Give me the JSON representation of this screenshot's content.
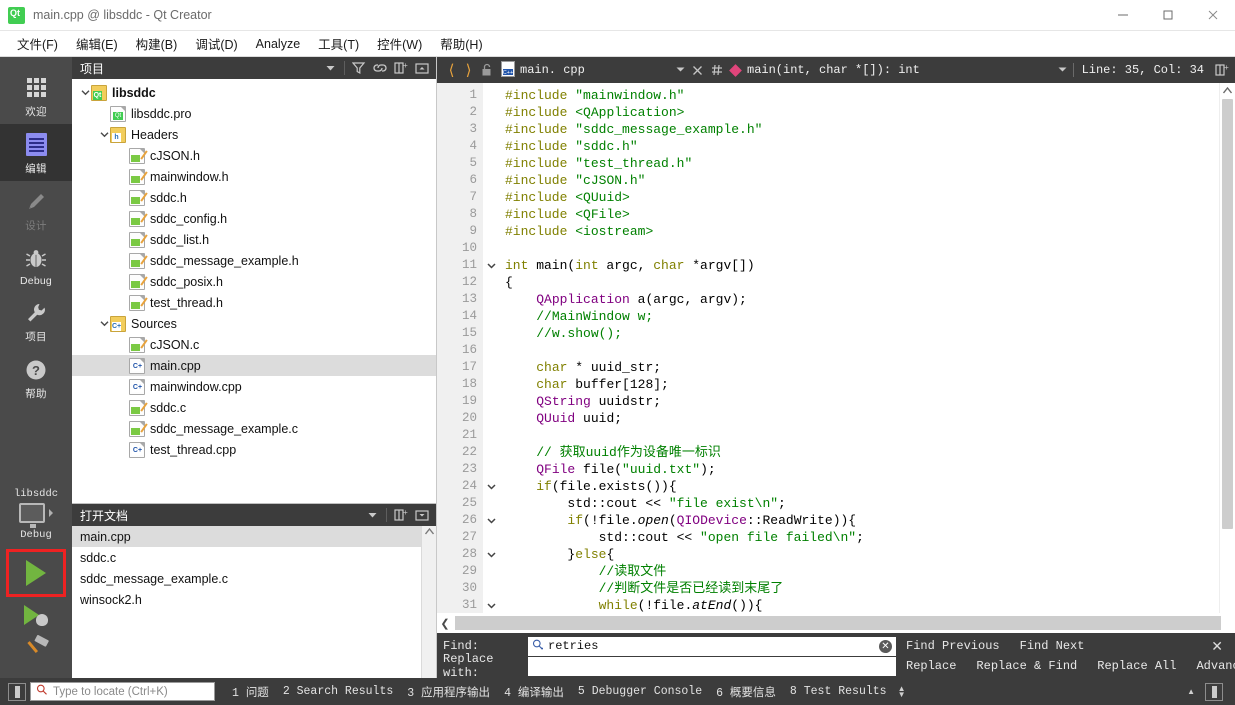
{
  "window": {
    "title": "main.cpp @ libsddc - Qt Creator",
    "logo_text": "Qt",
    "minimize": "–",
    "maximize": "□",
    "close": "✕"
  },
  "menubar": {
    "items": [
      {
        "label": "文件(F)"
      },
      {
        "label": "编辑(E)"
      },
      {
        "label": "构建(B)"
      },
      {
        "label": "调试(D)"
      },
      {
        "label": "Analyze"
      },
      {
        "label": "工具(T)"
      },
      {
        "label": "控件(W)"
      },
      {
        "label": "帮助(H)"
      }
    ]
  },
  "activitybar": {
    "modes": [
      {
        "label": "欢迎",
        "icon": "grid-icon",
        "state": "normal"
      },
      {
        "label": "编辑",
        "icon": "document-icon",
        "state": "active"
      },
      {
        "label": "设计",
        "icon": "pencil-icon",
        "state": "disabled"
      },
      {
        "label": "Debug",
        "icon": "bug-icon",
        "state": "normal"
      },
      {
        "label": "项目",
        "icon": "wrench-icon",
        "state": "normal"
      },
      {
        "label": "帮助",
        "icon": "help-icon",
        "state": "normal"
      }
    ],
    "kit": {
      "project": "libsddc",
      "build_config": "Debug",
      "icon": "monitor-icon"
    },
    "run_button": {
      "name": "run-button",
      "icon": "play-icon",
      "highlight_color": "#ee2222"
    },
    "debug_button": {
      "name": "start-debugging-button",
      "icon": "play-bug-icon"
    },
    "build_button": {
      "name": "build-button",
      "icon": "hammer-icon"
    }
  },
  "project_pane": {
    "title": "项目",
    "tools": [
      "filter-icon",
      "link-icon",
      "split-icon",
      "collapse-icon"
    ],
    "tree": [
      {
        "depth": 0,
        "label": "libsddc",
        "icon": "qt-folder-icon",
        "arrow": "down",
        "bold": true,
        "selected": false
      },
      {
        "depth": 1,
        "label": "libsddc.pro",
        "icon": "qt-pro-file-icon",
        "arrow": "none",
        "bold": false,
        "selected": false
      },
      {
        "depth": 1,
        "label": "Headers",
        "icon": "h-folder-icon",
        "arrow": "down",
        "bold": false,
        "selected": false
      },
      {
        "depth": 2,
        "label": "cJSON.h",
        "icon": "header-file-icon",
        "arrow": "none",
        "bold": false,
        "selected": false
      },
      {
        "depth": 2,
        "label": "mainwindow.h",
        "icon": "header-file-icon",
        "arrow": "none",
        "bold": false,
        "selected": false
      },
      {
        "depth": 2,
        "label": "sddc.h",
        "icon": "header-file-icon",
        "arrow": "none",
        "bold": false,
        "selected": false
      },
      {
        "depth": 2,
        "label": "sddc_config.h",
        "icon": "header-file-icon",
        "arrow": "none",
        "bold": false,
        "selected": false
      },
      {
        "depth": 2,
        "label": "sddc_list.h",
        "icon": "header-file-icon",
        "arrow": "none",
        "bold": false,
        "selected": false
      },
      {
        "depth": 2,
        "label": "sddc_message_example.h",
        "icon": "header-file-icon",
        "arrow": "none",
        "bold": false,
        "selected": false
      },
      {
        "depth": 2,
        "label": "sddc_posix.h",
        "icon": "header-file-icon",
        "arrow": "none",
        "bold": false,
        "selected": false
      },
      {
        "depth": 2,
        "label": "test_thread.h",
        "icon": "header-file-icon",
        "arrow": "none",
        "bold": false,
        "selected": false
      },
      {
        "depth": 1,
        "label": "Sources",
        "icon": "cpp-folder-icon",
        "arrow": "down",
        "bold": false,
        "selected": false
      },
      {
        "depth": 2,
        "label": "cJSON.c",
        "icon": "c-file-icon",
        "arrow": "none",
        "bold": false,
        "selected": false
      },
      {
        "depth": 2,
        "label": "main.cpp",
        "icon": "cpp-file-icon",
        "arrow": "none",
        "bold": false,
        "selected": true
      },
      {
        "depth": 2,
        "label": "mainwindow.cpp",
        "icon": "cpp-file-icon",
        "arrow": "none",
        "bold": false,
        "selected": false
      },
      {
        "depth": 2,
        "label": "sddc.c",
        "icon": "c-file-icon",
        "arrow": "none",
        "bold": false,
        "selected": false
      },
      {
        "depth": 2,
        "label": "sddc_message_example.c",
        "icon": "c-file-icon",
        "arrow": "none",
        "bold": false,
        "selected": false
      },
      {
        "depth": 2,
        "label": "test_thread.cpp",
        "icon": "cpp-file-icon",
        "arrow": "none",
        "bold": false,
        "selected": false
      }
    ]
  },
  "open_documents_pane": {
    "title": "打开文档",
    "tools": [
      "split-icon",
      "collapse-icon"
    ],
    "items": [
      {
        "label": "main.cpp",
        "selected": true
      },
      {
        "label": "sddc.c",
        "selected": false
      },
      {
        "label": "sddc_message_example.c",
        "selected": false
      },
      {
        "label": "winsock2.h",
        "selected": false
      }
    ]
  },
  "editor_toolbar": {
    "back_icon": "back-arrow-icon",
    "forward_icon": "forward-arrow-icon",
    "lock_icon": "unlocked-icon",
    "file_name": "main. cpp",
    "file_icon": "cpp-file-icon",
    "close_icon": "close-document-icon",
    "hash_icon": "hash-icon",
    "symbol": "main(int, char *[]): int",
    "symbol_icon": "function-diamond-icon",
    "cursor_position": "Line: 35, Col: 34",
    "split_icon": "split-editor-icon"
  },
  "code": {
    "lines": [
      {
        "n": 1,
        "fold": "",
        "html": "<span class='p'>#include</span> <span class='s'>\"mainwindow.h\"</span>"
      },
      {
        "n": 2,
        "fold": "",
        "html": "<span class='p'>#include</span> <span class='s'>&lt;QApplication&gt;</span>"
      },
      {
        "n": 3,
        "fold": "",
        "html": "<span class='p'>#include</span> <span class='s'>\"sddc_message_example.h\"</span>"
      },
      {
        "n": 4,
        "fold": "",
        "html": "<span class='p'>#include</span> <span class='s'>\"sddc.h\"</span>"
      },
      {
        "n": 5,
        "fold": "",
        "html": "<span class='p'>#include</span> <span class='s'>\"test_thread.h\"</span>"
      },
      {
        "n": 6,
        "fold": "",
        "html": "<span class='p'>#include</span> <span class='s'>\"cJSON.h\"</span>"
      },
      {
        "n": 7,
        "fold": "",
        "html": "<span class='p'>#include</span> <span class='s'>&lt;QUuid&gt;</span>"
      },
      {
        "n": 8,
        "fold": "",
        "html": "<span class='p'>#include</span> <span class='s'>&lt;QFile&gt;</span>"
      },
      {
        "n": 9,
        "fold": "",
        "html": "<span class='p'>#include</span> <span class='s'>&lt;iostream&gt;</span>"
      },
      {
        "n": 10,
        "fold": "",
        "html": ""
      },
      {
        "n": 11,
        "fold": "v",
        "html": "<span class='k'>int</span> main(<span class='k'>int</span> argc, <span class='k'>char</span> *argv[])"
      },
      {
        "n": 12,
        "fold": "",
        "html": "{"
      },
      {
        "n": 13,
        "fold": "",
        "html": "    <span class='t'>QApplication</span> a(argc, argv);"
      },
      {
        "n": 14,
        "fold": "",
        "html": "    <span class='c'>//MainWindow w;</span>"
      },
      {
        "n": 15,
        "fold": "",
        "html": "    <span class='c'>//w.show();</span>"
      },
      {
        "n": 16,
        "fold": "",
        "html": ""
      },
      {
        "n": 17,
        "fold": "",
        "html": "    <span class='k'>char</span> * uuid_str;"
      },
      {
        "n": 18,
        "fold": "",
        "html": "    <span class='k'>char</span> buffer[128];"
      },
      {
        "n": 19,
        "fold": "",
        "html": "    <span class='t'>QString</span> uuidstr;"
      },
      {
        "n": 20,
        "fold": "",
        "html": "    <span class='t'>QUuid</span> uuid;"
      },
      {
        "n": 21,
        "fold": "",
        "html": ""
      },
      {
        "n": 22,
        "fold": "",
        "html": "    <span class='c'>// 获取uuid作为设备唯一标识</span>"
      },
      {
        "n": 23,
        "fold": "",
        "html": "    <span class='t'>QFile</span> file(<span class='s'>\"uuid.txt\"</span>);"
      },
      {
        "n": 24,
        "fold": "v",
        "html": "    <span class='k'>if</span>(file.exists()){"
      },
      {
        "n": 25,
        "fold": "",
        "html": "        std::cout &lt;&lt; <span class='s'>\"file exist\\n\"</span>;"
      },
      {
        "n": 26,
        "fold": "v",
        "html": "        <span class='k'>if</span>(!file.<span class='it'>open</span>(<span class='t'>QIODevice</span>::ReadWrite)){"
      },
      {
        "n": 27,
        "fold": "",
        "html": "            std::cout &lt;&lt; <span class='s'>\"open file failed\\n\"</span>;"
      },
      {
        "n": 28,
        "fold": "v",
        "html": "        }<span class='k'>else</span>{"
      },
      {
        "n": 29,
        "fold": "",
        "html": "            <span class='c'>//读取文件</span>"
      },
      {
        "n": 30,
        "fold": "",
        "html": "            <span class='c'>//判断文件是否已经读到末尾了</span>"
      },
      {
        "n": 31,
        "fold": "v",
        "html": "            <span class='k'>while</span>(!file.<span class='it'>atEnd</span>()){"
      }
    ]
  },
  "find_bar": {
    "find_label": "Find:",
    "find_value": "retries",
    "find_icon": "search-icon",
    "clear_icon": "clear-icon",
    "replace_label": "Replace with:",
    "replace_value": "",
    "buttons_row1": [
      "Find Previous",
      "Find Next"
    ],
    "buttons_row2": [
      "Replace",
      "Replace & Find",
      "Replace All",
      "Advanced..."
    ],
    "close_icon": "close-icon"
  },
  "statusbar": {
    "sidebar_toggle_icon": "toggle-left-sidebar-icon",
    "locator_placeholder": "Type to locate (Ctrl+K)",
    "locator_icon": "search-icon",
    "panes": [
      {
        "num": "1",
        "label": "问题"
      },
      {
        "num": "2",
        "label": "Search Results"
      },
      {
        "num": "3",
        "label": "应用程序输出"
      },
      {
        "num": "4",
        "label": "编译输出"
      },
      {
        "num": "5",
        "label": "Debugger Console"
      },
      {
        "num": "6",
        "label": "概要信息"
      },
      {
        "num": "8",
        "label": "Test Results"
      }
    ],
    "right_toggle_icon": "toggle-right-sidebar-icon"
  }
}
